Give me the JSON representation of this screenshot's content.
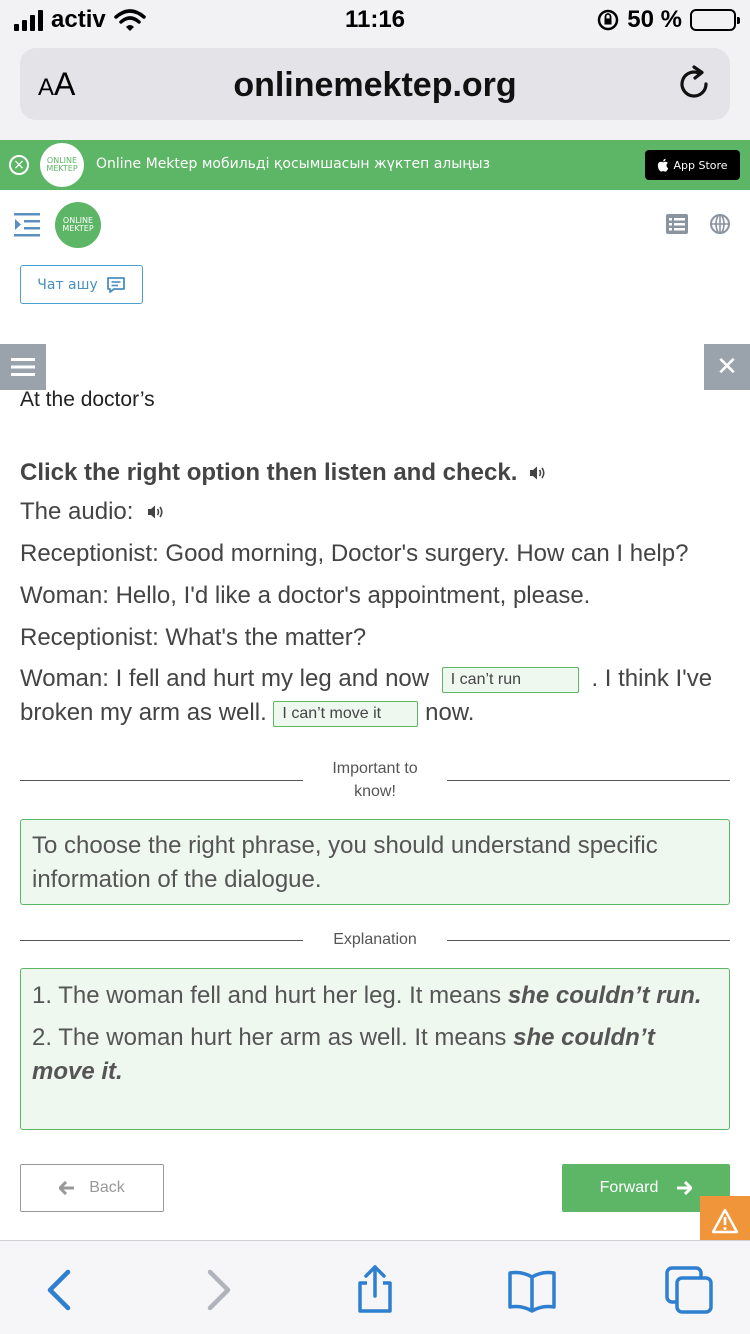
{
  "status_bar": {
    "carrier": "activ",
    "time": "11:16",
    "battery_percent": "50 %",
    "battery_level": 0.4
  },
  "browser": {
    "text_size_label_small": "A",
    "text_size_label_large": "A",
    "url": "onlinemektep.org"
  },
  "banner": {
    "logo_text": "ONLINE MEKTEP",
    "text": "Online Mektep мобильді қосымшасын жүктеп алыңыз",
    "appstore_label": "App Store"
  },
  "header": {
    "logo_text": "ONLINE MEKTEP",
    "chat_button": "Чат ашу"
  },
  "lesson": {
    "section_title": "At the doctor’s",
    "instruction": "Click the right option then listen and check.",
    "audio_label": "The audio:",
    "lines": [
      "Receptionist: Good morning, Doctor's surgery. How can I help?",
      "Woman: Hello, I'd like a doctor's appointment, please.",
      "Receptionist: What's the matter?"
    ],
    "para": {
      "part1": "Woman: I fell and hurt my leg and now",
      "answer1": "I can’t run",
      "part2": ". I think I've broken my arm as well.",
      "answer2": "I can’t move it",
      "part3": "now."
    }
  },
  "important": {
    "label_line1": "Important to",
    "label_line2": "know!",
    "text": "To choose the right phrase, you should understand specific information of the dialogue."
  },
  "explanation": {
    "label": "Explanation",
    "items": [
      {
        "prefix": "1. The woman fell and hurt her leg. It means ",
        "bold": "she couldn’t run."
      },
      {
        "prefix": "2. The woman hurt her arm as well. It means ",
        "bold": "she couldn’t move it."
      }
    ]
  },
  "nav": {
    "back": "Back",
    "forward": "Forward"
  },
  "colors": {
    "brand_green": "#5db566",
    "accent_blue": "#2f7fd0",
    "warning_orange": "#f0953a"
  }
}
